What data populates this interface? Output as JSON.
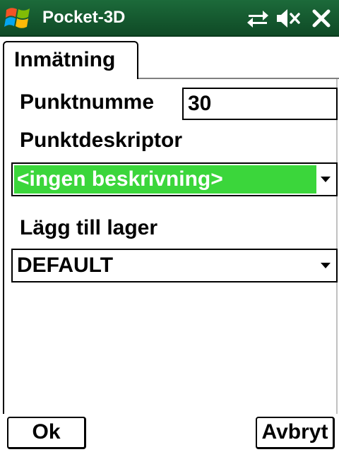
{
  "titlebar": {
    "title": "Pocket-3D",
    "icons": [
      "windows-logo-icon",
      "sync-icon",
      "speaker-muted-icon",
      "close-icon"
    ]
  },
  "tab": {
    "label": "Inmätning"
  },
  "form": {
    "point_number_label": "Punktnumme",
    "point_number_value": "30",
    "descriptor_label": "Punktdeskriptor",
    "descriptor_value": "<ingen beskrivning>",
    "layer_label": "Lägg till lager",
    "layer_value": "DEFAULT"
  },
  "buttons": {
    "ok": "Ok",
    "cancel": "Avbryt"
  },
  "colors": {
    "titlebar": "#14532d",
    "selection": "#3bd63b"
  }
}
